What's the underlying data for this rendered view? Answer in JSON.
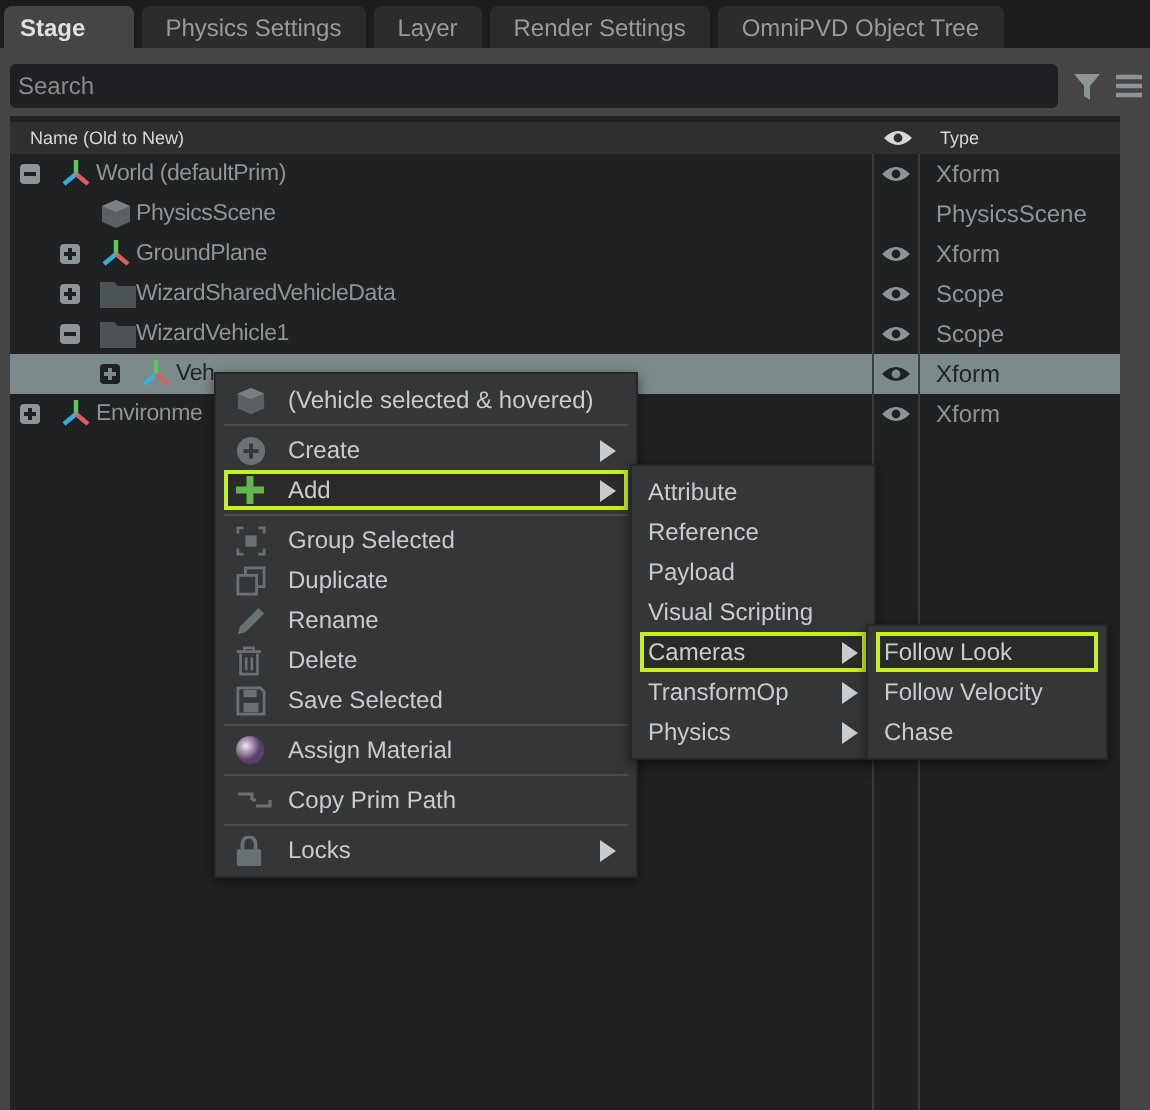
{
  "tabs": [
    {
      "label": "Stage",
      "selected": true
    },
    {
      "label": "Physics Settings",
      "selected": false
    },
    {
      "label": "Layer",
      "selected": false
    },
    {
      "label": "Render Settings",
      "selected": false
    },
    {
      "label": "OmniPVD Object Tree",
      "selected": false
    }
  ],
  "search": {
    "placeholder": "Search"
  },
  "columns": {
    "name": "Name (Old to New)",
    "type": "Type"
  },
  "tree": [
    {
      "name": "World (defaultPrim)",
      "kind": "xform",
      "type": "Xform",
      "visible": true,
      "selected": false,
      "expanded": true,
      "children": [
        {
          "name": "PhysicsScene",
          "kind": "physics",
          "type": "PhysicsScene",
          "visible": false,
          "selected": false
        },
        {
          "name": "GroundPlane",
          "kind": "xform",
          "type": "Xform",
          "visible": true,
          "selected": false,
          "expanded": false
        },
        {
          "name": "WizardSharedVehicleData",
          "kind": "scope",
          "type": "Scope",
          "visible": true,
          "selected": false,
          "expanded": false
        },
        {
          "name": "WizardVehicle1",
          "kind": "scope",
          "type": "Scope",
          "visible": true,
          "selected": false,
          "expanded": true,
          "children": [
            {
              "name": "Veh",
              "kind": "xform",
              "type": "Xform",
              "visible": true,
              "selected": true,
              "expanded": false
            }
          ]
        }
      ]
    },
    {
      "name": "Environme",
      "kind": "xform",
      "type": "Xform",
      "visible": true,
      "selected": false,
      "expanded": false
    }
  ],
  "context_menu": {
    "title": "(Vehicle selected & hovered)",
    "groups": [
      [
        {
          "label": "Create",
          "submenu": true,
          "selected": false
        },
        {
          "label": "Add",
          "submenu": true,
          "selected": true
        }
      ],
      [
        {
          "label": "Group Selected",
          "submenu": false,
          "selected": false
        },
        {
          "label": "Duplicate",
          "submenu": false,
          "selected": false
        },
        {
          "label": "Rename",
          "submenu": false,
          "selected": false
        },
        {
          "label": "Delete",
          "submenu": false,
          "selected": false
        },
        {
          "label": "Save Selected",
          "submenu": false,
          "selected": false
        }
      ],
      [
        {
          "label": "Assign Material",
          "submenu": false,
          "selected": false
        }
      ],
      [
        {
          "label": "Copy Prim Path",
          "submenu": false,
          "selected": false
        }
      ],
      [
        {
          "label": "Locks",
          "submenu": true,
          "selected": false
        }
      ]
    ]
  },
  "add_menu": [
    {
      "label": "Attribute",
      "submenu": false,
      "selected": false
    },
    {
      "label": "Reference",
      "submenu": false,
      "selected": false
    },
    {
      "label": "Payload",
      "submenu": false,
      "selected": false
    },
    {
      "label": "Visual Scripting",
      "submenu": false,
      "selected": false
    },
    {
      "label": "Cameras",
      "submenu": true,
      "selected": true
    },
    {
      "label": "TransformOp",
      "submenu": true,
      "selected": false
    },
    {
      "label": "Physics",
      "submenu": true,
      "selected": false
    }
  ],
  "cameras_menu": [
    {
      "label": "Follow Look",
      "selected": true
    },
    {
      "label": "Follow Velocity",
      "selected": false
    },
    {
      "label": "Chase",
      "selected": false
    }
  ]
}
